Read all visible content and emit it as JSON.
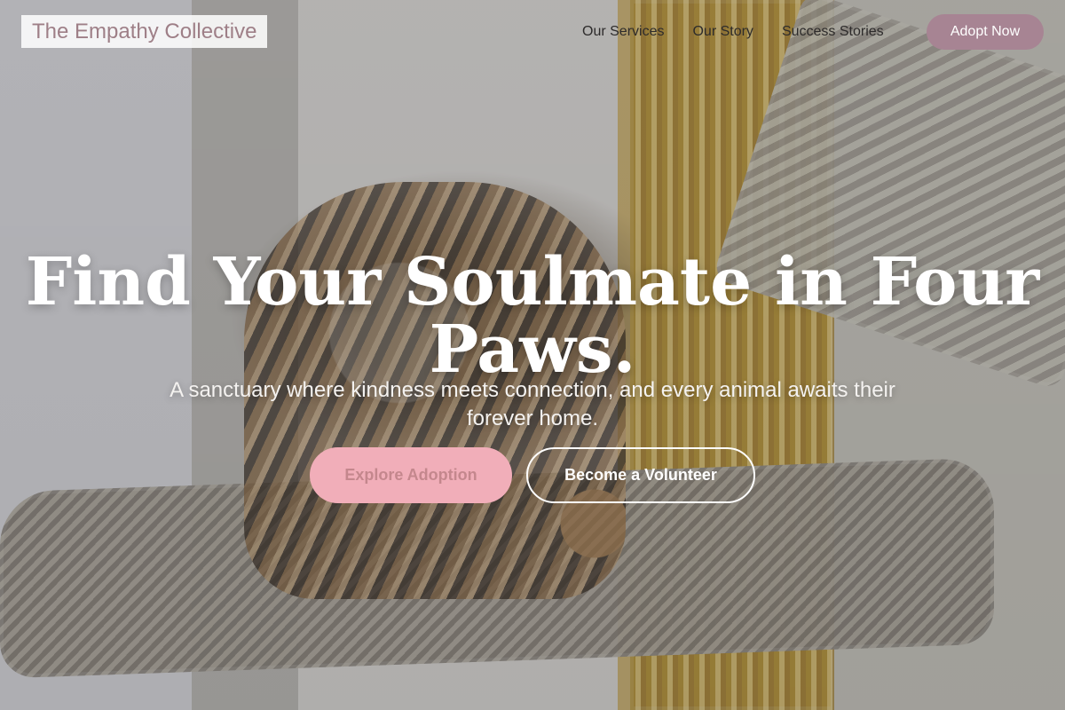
{
  "brand": {
    "name": "The Empathy Collective"
  },
  "navigation": {
    "items": [
      "Our Services",
      "Our Story",
      "Success Stories"
    ],
    "cta_label": "Adopt Now"
  },
  "hero": {
    "headline": "Find Your Soulmate in Four Paws.",
    "subheadline": "A sanctuary where kindness meets connection, and every animal awaits their forever home.",
    "primary_button": "Explore Adoption",
    "secondary_button": "Become a Volunteer"
  },
  "colors": {
    "accent": "#a78493",
    "primary_button": "#f1aeb9",
    "primary_button_text": "#c4878d",
    "headline": "#ffffff"
  }
}
